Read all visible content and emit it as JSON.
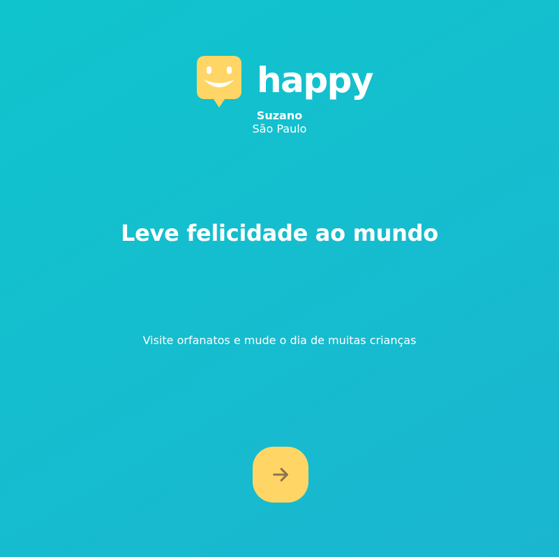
{
  "brand": {
    "name": "happy",
    "logo_color": "#ffd666"
  },
  "location": {
    "city": "Suzano",
    "state": "São Paulo"
  },
  "hero": {
    "headline": "Leve felicidade ao mundo",
    "subtitle": "Visite orfanatos e mude o dia de muitas crianças"
  },
  "enter_button": {
    "icon": "arrow-right-icon",
    "background": "#ffd666",
    "icon_color": "#8d734b"
  },
  "theme": {
    "gradient_start": "#1ab6d0",
    "gradient_end": "#10c4cd",
    "text": "#ffffff"
  }
}
